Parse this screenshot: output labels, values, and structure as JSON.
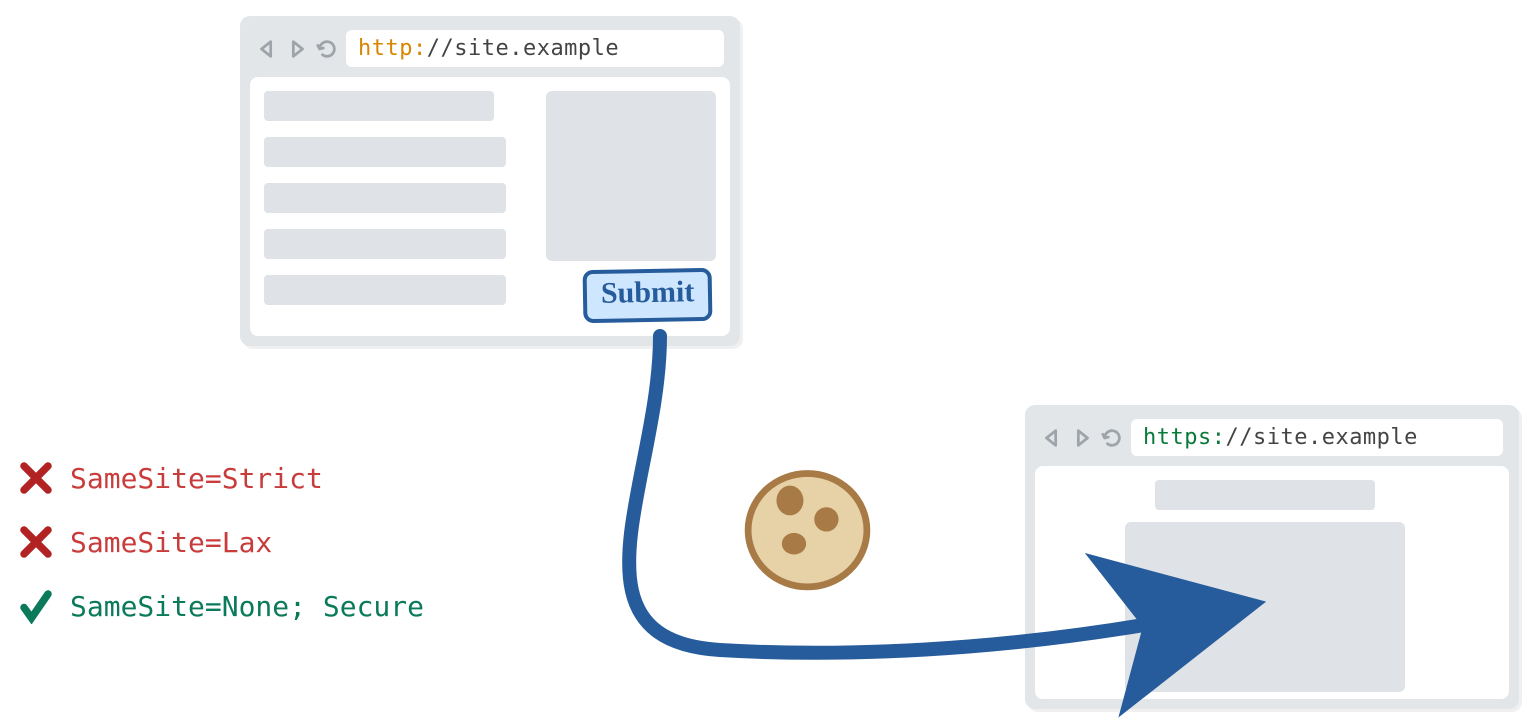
{
  "browserTop": {
    "scheme": "http:",
    "host": "//site.example",
    "submitLabel": "Submit"
  },
  "browserBottom": {
    "scheme": "https:",
    "host": "//site.example"
  },
  "legend": {
    "strict": "SameSite=Strict",
    "lax": "SameSite=Lax",
    "noneSecure": "SameSite=None; Secure"
  }
}
